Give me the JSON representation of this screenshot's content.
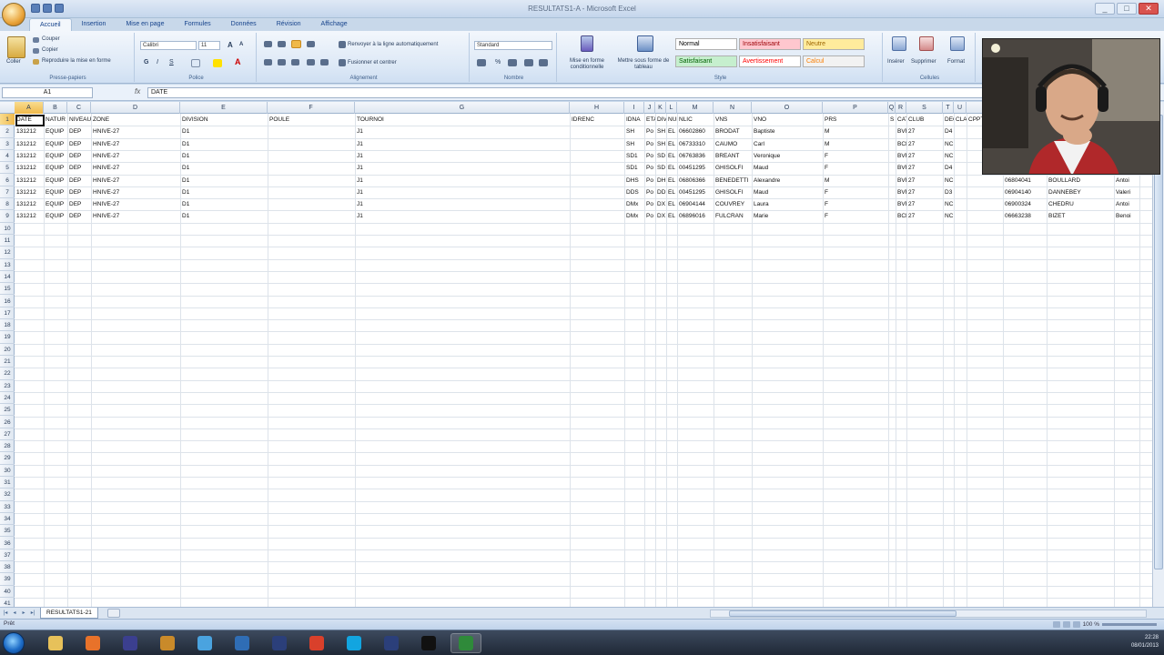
{
  "window": {
    "title": "RESULTATS1-A - Microsoft Excel",
    "min": "_",
    "max": "□",
    "close": "✕"
  },
  "tabs": [
    {
      "label": "Accueil",
      "active": true
    },
    {
      "label": "Insertion"
    },
    {
      "label": "Mise en page"
    },
    {
      "label": "Formules"
    },
    {
      "label": "Données"
    },
    {
      "label": "Révision"
    },
    {
      "label": "Affichage"
    }
  ],
  "ribbon": {
    "clipboard": {
      "paste": "Coller",
      "cut": "Couper",
      "copy": "Copier",
      "format_painter": "Reproduire la mise en forme",
      "label": "Presse-papiers"
    },
    "font": {
      "family": "Calibri",
      "size": "11",
      "bold": "G",
      "italic": "I",
      "underline": "S",
      "label": "Police"
    },
    "alignment": {
      "wrap": "Renvoyer à la ligne automatiquement",
      "merge": "Fusionner et centrer",
      "label": "Alignement"
    },
    "number": {
      "format": "Standard",
      "label": "Nombre"
    },
    "styles": {
      "conditional": "Mise en forme conditionnelle",
      "as_table": "Mettre sous forme de tableau",
      "cells": [
        {
          "label": "Normal",
          "bg": "#ffffff",
          "fg": "#000000"
        },
        {
          "label": "Insatisfaisant",
          "bg": "#ffc7ce",
          "fg": "#9c0006"
        },
        {
          "label": "Neutre",
          "bg": "#ffeb9c",
          "fg": "#9c6500"
        },
        {
          "label": "Satisfaisant",
          "bg": "#c6efce",
          "fg": "#006100"
        },
        {
          "label": "Avertissement",
          "bg": "#ffffff",
          "fg": "#ff0000"
        },
        {
          "label": "Calcul",
          "bg": "#f2f2f2",
          "fg": "#fa7d00"
        }
      ],
      "label": "Style"
    },
    "cells_group": {
      "insert": "Insérer",
      "delete": "Supprimer",
      "format": "Format",
      "label": "Cellules"
    }
  },
  "formula_bar": {
    "name_box": "A1",
    "fx": "fx",
    "value": "DATE"
  },
  "grid": {
    "columns": [
      "A",
      "B",
      "C",
      "D",
      "E",
      "F",
      "G",
      "H",
      "I",
      "J",
      "K",
      "L",
      "M",
      "N",
      "O",
      "P",
      "Q",
      "R",
      "S",
      "T",
      "U",
      "V",
      "W",
      "X",
      "Y"
    ],
    "rows": [
      "1",
      "2",
      "3",
      "4",
      "5",
      "6",
      "7",
      "8",
      "9",
      "10",
      "11",
      "12",
      "13",
      "14",
      "15",
      "16",
      "17",
      "18",
      "19",
      "20",
      "21",
      "22",
      "23",
      "24",
      "25",
      "26",
      "27",
      "28",
      "29",
      "30",
      "31",
      "32",
      "33",
      "34",
      "35",
      "36",
      "37",
      "38",
      "39",
      "40",
      "41"
    ],
    "header": [
      "DATE",
      "NATUR",
      "NIVEAU",
      "ZONE",
      "DIVISION",
      "POULE",
      "TOURNOI",
      "IDRENC",
      "IDNA",
      "ETAT",
      "DIV",
      "NUM",
      "NLIC",
      "VNS",
      "VNO",
      "PRS",
      "S",
      "CATE",
      "CLUB",
      "DEC",
      "CLA",
      "CPPTS"
    ],
    "data": [
      [
        "131212",
        "EQUIP",
        "DEP",
        "HNIVE-27",
        "D1",
        "",
        "J1",
        "",
        "SH",
        "Po",
        "SH",
        "EL",
        "06602860",
        "BRODAT",
        "Baptiste",
        "M",
        "",
        "BVRL",
        "27",
        "D4",
        "",
        "",
        "",
        "",
        ""
      ],
      [
        "131212",
        "EQUIP",
        "DEP",
        "HNIVE-27",
        "D1",
        "",
        "J1",
        "",
        "SH",
        "Po",
        "SH",
        "EL",
        "06733310",
        "CAUMO",
        "Carl",
        "M",
        "",
        "BCR",
        "27",
        "NC",
        "",
        "",
        "",
        "",
        ""
      ],
      [
        "131212",
        "EQUIP",
        "DEP",
        "HNIVE-27",
        "D1",
        "",
        "J1",
        "",
        "SD1",
        "Po",
        "SD",
        "EL",
        "06763836",
        "BREANT",
        "Veronique",
        "F",
        "",
        "BVRL",
        "27",
        "NC",
        "",
        "",
        "",
        "",
        ""
      ],
      [
        "131212",
        "EQUIP",
        "DEP",
        "HNIVE-27",
        "D1",
        "",
        "J1",
        "",
        "SD1",
        "Po",
        "SD",
        "EL",
        "00451295",
        "GHISOLFI",
        "Maud",
        "F",
        "",
        "BVRL",
        "27",
        "D4",
        "",
        "",
        "",
        "",
        ""
      ],
      [
        "131212",
        "EQUIP",
        "DEP",
        "HNIVE-27",
        "D1",
        "",
        "J1",
        "",
        "DHS",
        "Po",
        "DH",
        "EL",
        "06806366",
        "BENEDETTI",
        "Alexandre",
        "M",
        "",
        "BVRL",
        "27",
        "NC",
        "",
        "",
        "06804041",
        "BOULLARD",
        "Antoi"
      ],
      [
        "131212",
        "EQUIP",
        "DEP",
        "HNIVE-27",
        "D1",
        "",
        "J1",
        "",
        "DDS",
        "Po",
        "DD",
        "EL",
        "00451295",
        "GHISOLFI",
        "Maud",
        "F",
        "",
        "BVRL",
        "27",
        "D3",
        "",
        "",
        "06904140",
        "DANNEBEY",
        "Valeri"
      ],
      [
        "131212",
        "EQUIP",
        "DEP",
        "HNIVE-27",
        "D1",
        "",
        "J1",
        "",
        "DMx",
        "Po",
        "DX",
        "EL",
        "06904144",
        "COUVREY",
        "Laura",
        "F",
        "",
        "BVRL",
        "27",
        "NC",
        "",
        "",
        "06900324",
        "CHEDRU",
        "Antoi"
      ],
      [
        "131212",
        "EQUIP",
        "DEP",
        "HNIVE-27",
        "D1",
        "",
        "J1",
        "",
        "DMx",
        "Po",
        "DX",
        "EL",
        "06896016",
        "FULCRAN",
        "Marie",
        "F",
        "",
        "BCR",
        "27",
        "NC",
        "",
        "",
        "06663238",
        "BIZET",
        "Benoi"
      ]
    ]
  },
  "sheet_tabs": {
    "active": "RESULTATS1-21",
    "nav": [
      "|◂",
      "◂",
      "▸",
      "▸|"
    ]
  },
  "status": {
    "text": "Prêt",
    "zoom": "100 %"
  },
  "taskbar": {
    "apps": [
      {
        "name": "explorer",
        "color": "#e7c15a"
      },
      {
        "name": "firefox",
        "color": "#e8722a"
      },
      {
        "name": "eclipse",
        "color": "#3b3f8f"
      },
      {
        "name": "tool",
        "color": "#c98a2a"
      },
      {
        "name": "ie",
        "color": "#4aa3df"
      },
      {
        "name": "thunderbird",
        "color": "#2f6db5"
      },
      {
        "name": "app-blue",
        "color": "#2b3f7a"
      },
      {
        "name": "chrome",
        "color": "#d9402b"
      },
      {
        "name": "skype",
        "color": "#12a5e0"
      },
      {
        "name": "app-blue-2",
        "color": "#2b3f7a"
      },
      {
        "name": "media",
        "color": "#111111"
      },
      {
        "name": "excel",
        "color": "#2f8a3a"
      }
    ],
    "clock": "22:28",
    "date": "08/01/2013"
  }
}
